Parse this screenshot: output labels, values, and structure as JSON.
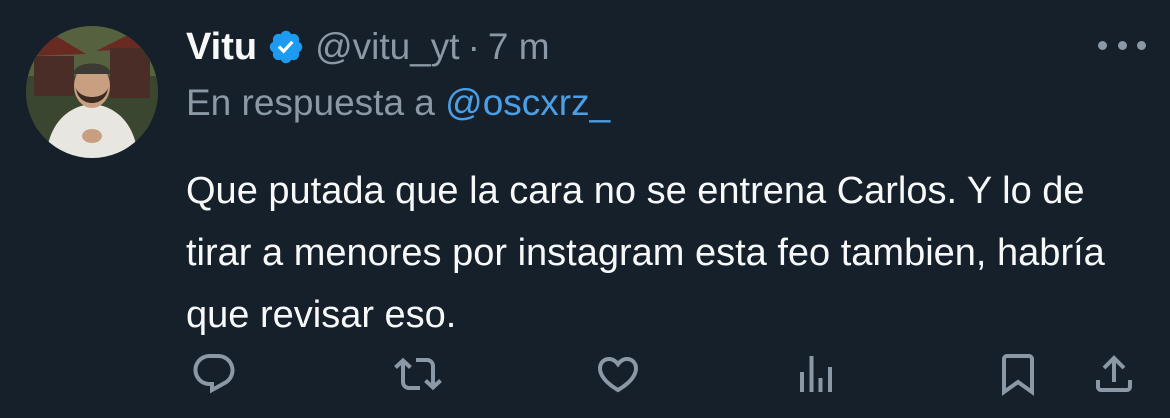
{
  "tweet": {
    "author_name": "Vitu",
    "handle": "@vitu_yt",
    "separator": "·",
    "time": "7 m",
    "reply_prefix": "En respuesta a ",
    "reply_to": "@oscxrz_",
    "text": "Que putada que la cara no se entrena Carlos. Y lo de tirar a menores por instagram esta feo tambien, habría que revisar eso."
  },
  "icons": {
    "verified": "verified-badge-icon",
    "more": "more-icon",
    "reply": "reply-icon",
    "retweet": "retweet-icon",
    "like": "like-icon",
    "views": "views-icon",
    "bookmark": "bookmark-icon",
    "share": "share-icon"
  },
  "colors": {
    "background": "#15202b",
    "text": "#f7f9f9",
    "secondary": "#8b98a5",
    "accent": "#1d9bf0",
    "mention": "#4a9fe6"
  }
}
